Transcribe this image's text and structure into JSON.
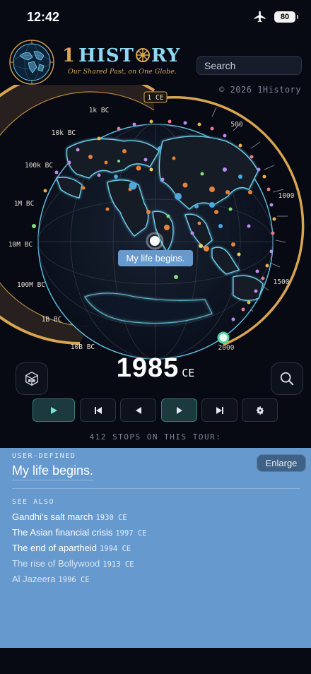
{
  "status_bar": {
    "time": "12:42",
    "battery": "80",
    "airplane_icon": "airplane-icon"
  },
  "brand": {
    "number": "1",
    "title_a": "HIST",
    "title_b": "RY",
    "tagline": "Our Shared Past, on One Globe."
  },
  "search": {
    "placeholder": "Search"
  },
  "copyright": "© 2026 1History",
  "timeline": {
    "outer_labels": [
      "1 CE",
      "1k BC",
      "10k BC",
      "100k BC",
      "1M BC",
      "10M BC",
      "100M BC",
      "1B BC",
      "10B BC"
    ],
    "inner_labels": [
      "500",
      "1000",
      "1500",
      "2000"
    ]
  },
  "globe": {
    "event_label": "My life begins."
  },
  "year": {
    "value": "1985",
    "era": "CE"
  },
  "controls": {
    "icons": [
      "play-icon",
      "skip-back-icon",
      "step-back-icon",
      "step-forward-icon",
      "skip-forward-icon",
      "gear-icon"
    ]
  },
  "tour": {
    "stops_text": "412 STOPS ON THIS TOUR:"
  },
  "panel": {
    "kicker": "USER-DEFINED",
    "title": "My life begins.",
    "enlarge_label": "Enlarge",
    "see_also_label": "SEE ALSO",
    "see_also": [
      {
        "title": "Gandhi's salt march",
        "year": "1930 CE"
      },
      {
        "title": "The Asian financial crisis",
        "year": "1997 CE"
      },
      {
        "title": "The end of apartheid",
        "year": "1994 CE"
      },
      {
        "title": "The rise of Bollywood",
        "year": "1913 CE"
      },
      {
        "title": "Al Jazeera",
        "year": "1996 CE"
      }
    ]
  },
  "colors": {
    "accent_gold": "#d9a650",
    "globe_glow": "#5fc8e8",
    "panel_blue": "#6699cd",
    "background": "#070913"
  }
}
